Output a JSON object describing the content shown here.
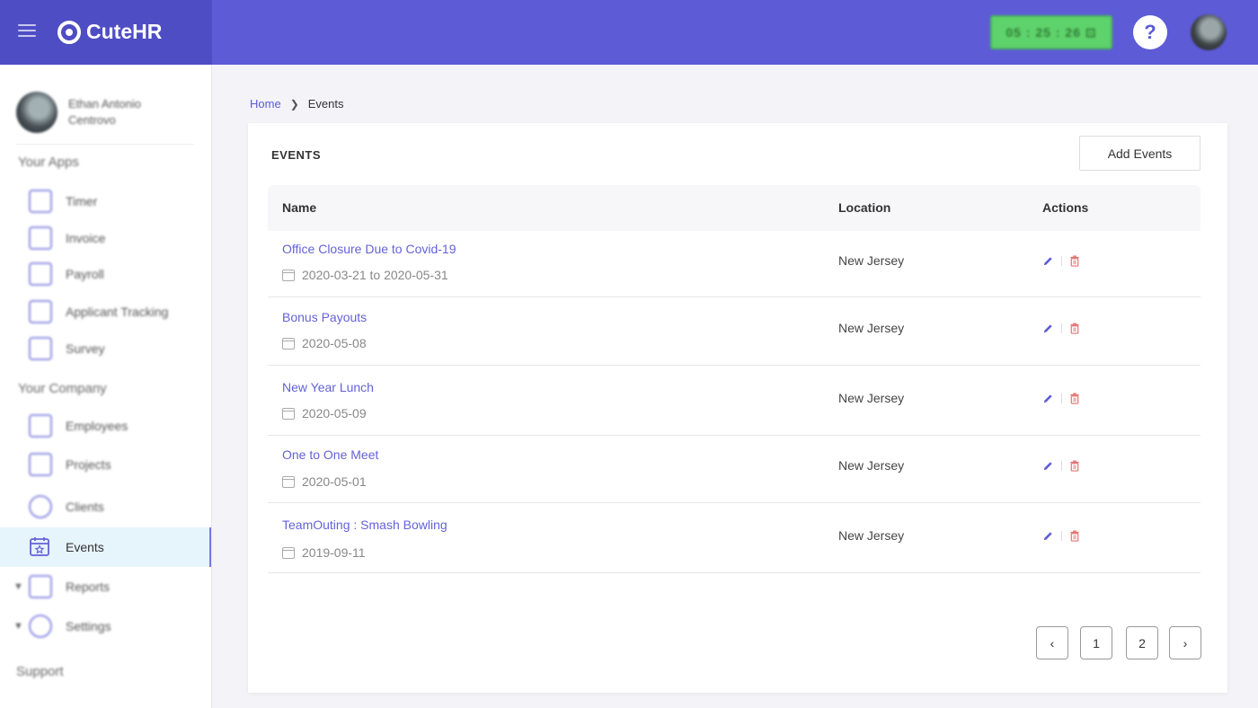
{
  "header": {
    "brand_name": "CuteHR",
    "timer": "05 : 25 : 26 ⊡",
    "help_label": "?"
  },
  "sidebar": {
    "user_name": "Ethan Antonio Centrovo",
    "apps_label": "Your Apps",
    "apps": [
      {
        "label": "Timer",
        "icon": "timer-icon"
      },
      {
        "label": "Invoice",
        "icon": "invoice-icon"
      },
      {
        "label": "Payroll",
        "icon": "payroll-icon"
      },
      {
        "label": "Applicant Tracking",
        "icon": "applicant-tracking-icon"
      },
      {
        "label": "Survey",
        "icon": "survey-icon"
      }
    ],
    "company_label": "Your Company",
    "company": [
      {
        "label": "Employees",
        "icon": "employees-icon"
      },
      {
        "label": "Projects",
        "icon": "projects-icon"
      },
      {
        "label": "Clients",
        "icon": "clients-icon"
      },
      {
        "label": "Events",
        "icon": "events-icon",
        "active": true
      },
      {
        "label": "Reports",
        "icon": "reports-icon",
        "expandable": true
      },
      {
        "label": "Settings",
        "icon": "settings-icon",
        "expandable": true
      }
    ],
    "support_label": "Support"
  },
  "breadcrumb": {
    "home": "Home",
    "current": "Events"
  },
  "events_card": {
    "title": "EVENTS",
    "add_button": "Add Events",
    "columns": {
      "name": "Name",
      "location": "Location",
      "actions": "Actions"
    },
    "rows": [
      {
        "name": "Office Closure Due to Covid-19",
        "date": "2020-03-21 to 2020-05-31",
        "location": "New Jersey"
      },
      {
        "name": "Bonus Payouts",
        "date": "2020-05-08",
        "location": "New Jersey"
      },
      {
        "name": "New Year Lunch",
        "date": "2020-05-09",
        "location": "New Jersey"
      },
      {
        "name": "One to One Meet",
        "date": "2020-05-01",
        "location": "New Jersey"
      },
      {
        "name": "TeamOuting : Smash Bowling",
        "date": "2019-09-11",
        "location": "New Jersey"
      }
    ]
  },
  "pagination": {
    "prev": "‹",
    "pages": [
      "1",
      "2"
    ],
    "next": "›"
  },
  "colors": {
    "header": "#5d5bd6",
    "brand_bg": "#4f4dc4",
    "link": "#6462d8",
    "timer": "#5fd36b",
    "delete": "#e57373"
  }
}
